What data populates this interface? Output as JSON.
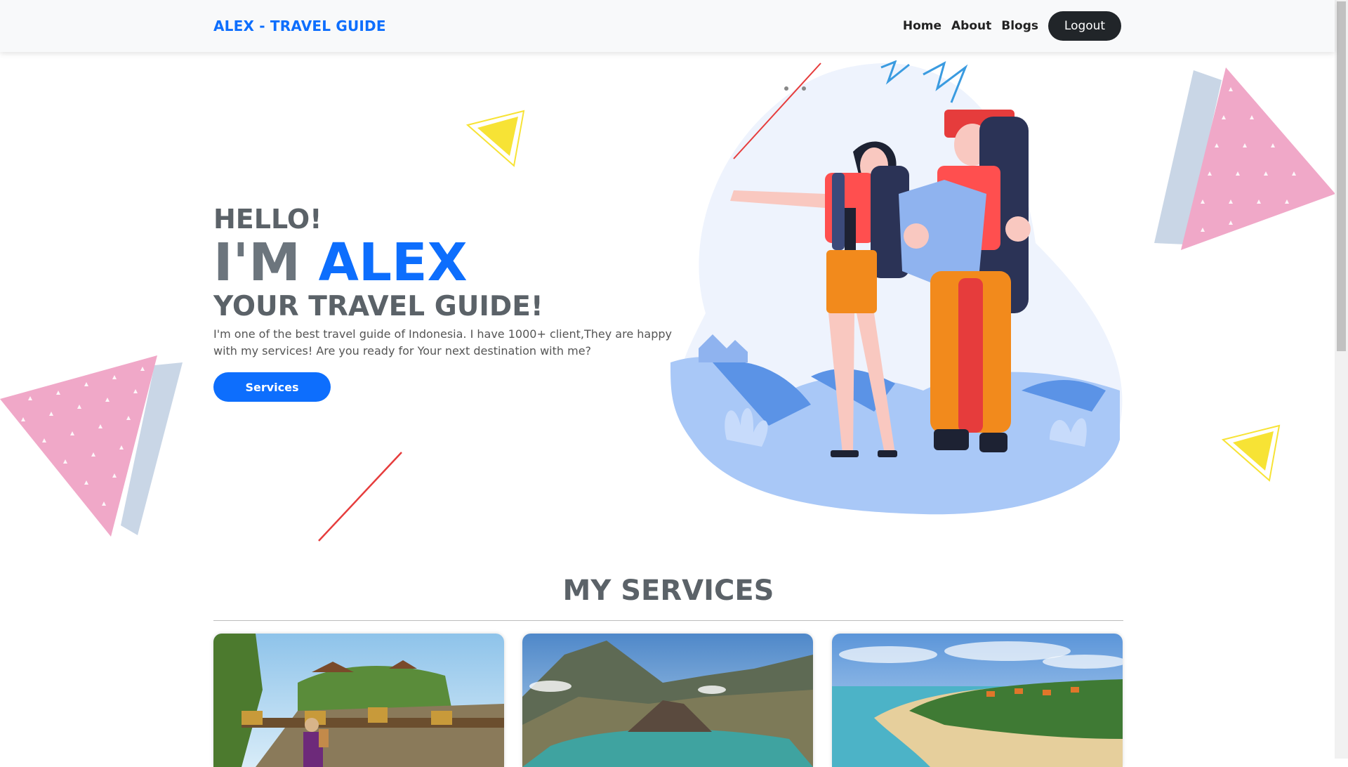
{
  "navbar": {
    "brand": "ALEX - TRAVEL GUIDE",
    "links": [
      {
        "label": "Home"
      },
      {
        "label": "About"
      },
      {
        "label": "Blogs"
      }
    ],
    "logout_label": "Logout"
  },
  "hero": {
    "hello": "HELLO!",
    "im": "I'M ",
    "name": "ALEX",
    "subtitle": "YOUR TRAVEL GUIDE!",
    "description": "I'm one of the best travel guide of Indonesia. I have 1000+ client,They are happy with my services! Are you ready for Your next destination with me?",
    "button_label": "Services"
  },
  "services": {
    "title": "MY SERVICES",
    "cards": [
      {
        "image": "temple-cliff-photo"
      },
      {
        "image": "volcano-crater-lake-photo"
      },
      {
        "image": "tropical-beach-photo"
      }
    ]
  },
  "colors": {
    "brand": "#0d6efd",
    "dark_button": "#212529",
    "heading": "#5b6268",
    "pink": "#f0a8c8",
    "yellow": "#f7e335",
    "decoration_red": "#e63c3c"
  }
}
